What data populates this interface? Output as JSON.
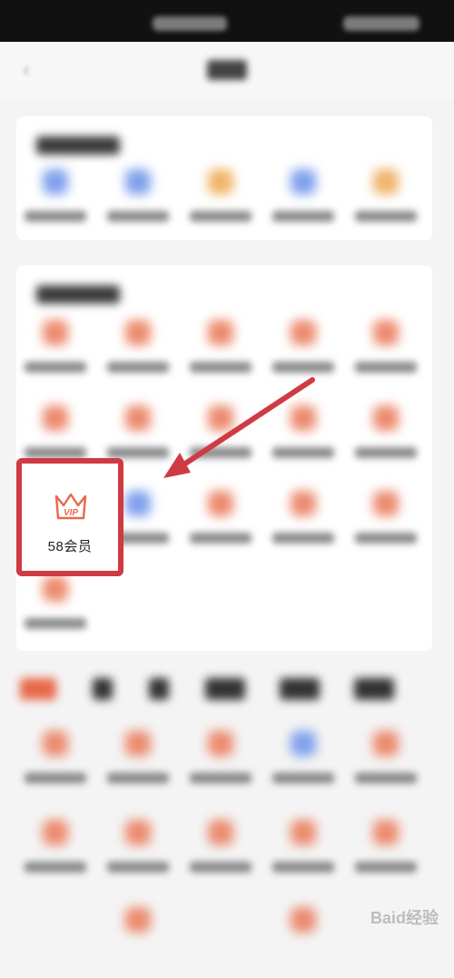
{
  "highlight": {
    "label": "58会员",
    "badge": "VIP"
  },
  "watermark": {
    "text": "Baid经验"
  },
  "colors": {
    "accent": "#e8684a",
    "blue": "#6b8fe8",
    "highlight_border": "#cf3a44",
    "arrow": "#cf3a44"
  }
}
